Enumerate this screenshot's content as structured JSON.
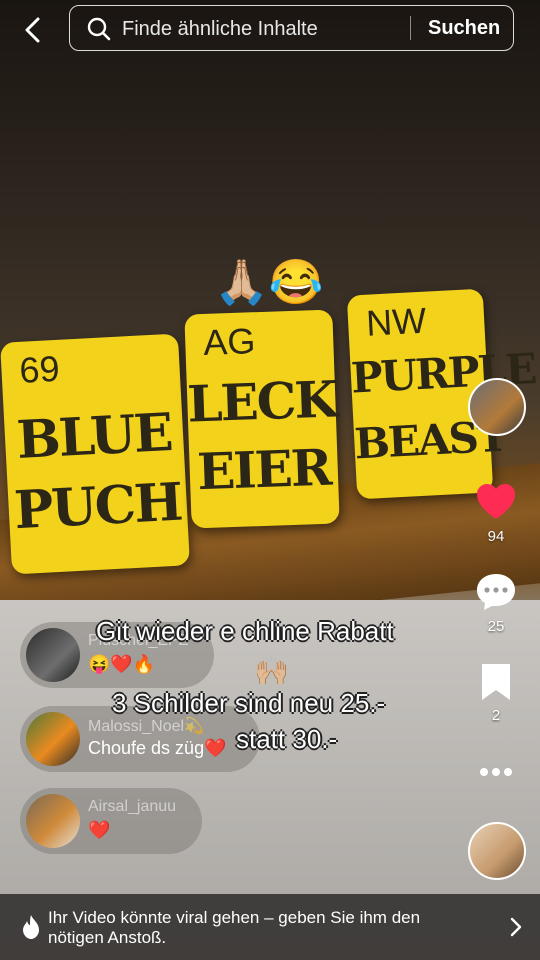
{
  "search": {
    "placeholder": "Finde ähnliche Inhalte",
    "button": "Suchen"
  },
  "video": {
    "emoji_top": "🙏🏼😂",
    "signs": [
      {
        "code": "69",
        "line1": "BLUE",
        "line2": "PUCH"
      },
      {
        "code": "AG",
        "line1": "LECK",
        "line2": "EIER"
      },
      {
        "code": "NW",
        "line1": "PURPLE",
        "line2": "BEAST"
      }
    ],
    "caption": {
      "line1": "Git wieder e chline Rabatt",
      "emoji": "🙌🏼",
      "line2": "3 Schilder sind neu 25.-",
      "line3": "statt 30.-"
    }
  },
  "actions": {
    "likes": "94",
    "comments": "25",
    "saves": "2"
  },
  "comments": [
    {
      "user": "Pluschel_EPZ",
      "text": "😝❤️🔥"
    },
    {
      "user": "Malossi_Noel💫",
      "text": "Choufe ds züg❤️"
    },
    {
      "user": "Airsal_januu",
      "text": "❤️"
    }
  ],
  "banner": {
    "text": "Ihr Video könnte viral gehen – geben Sie ihm den nötigen Anstoß."
  },
  "colors": {
    "like": "#fe2c55",
    "sign": "#f2d21b"
  }
}
